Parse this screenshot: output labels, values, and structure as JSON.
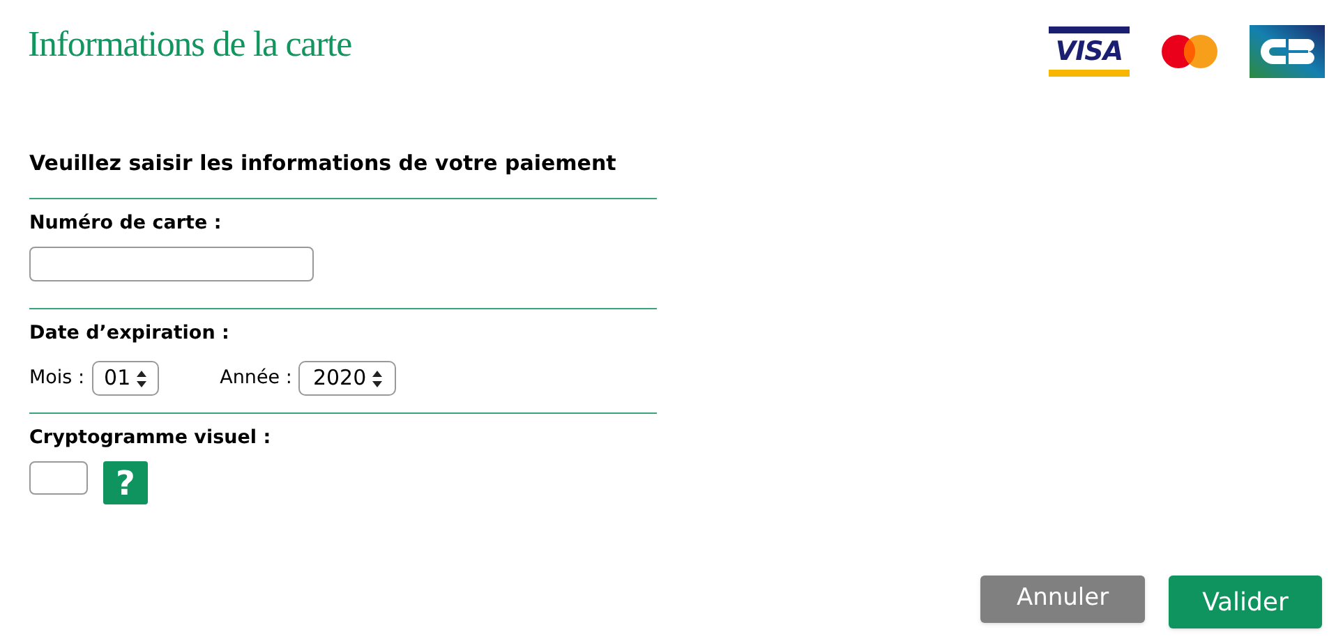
{
  "title": "Informations de la carte",
  "card_logos": [
    {
      "kind": "visa",
      "text": "VISA"
    },
    {
      "kind": "mastercard"
    },
    {
      "kind": "cb"
    }
  ],
  "heading": "Veuillez saisir les informations de votre paiement",
  "card_number": {
    "label": "Numéro de carte :"
  },
  "expiry": {
    "label": "Date d’expiration :",
    "month_label": "Mois :",
    "month": "01",
    "year_label": "Année :",
    "year": "2020"
  },
  "cvv": {
    "label": "Cryptogramme visuel :",
    "help": "?"
  },
  "buttons": [
    {
      "kind": "secondary",
      "label": "Annuler"
    },
    {
      "kind": "primary",
      "label": "Valider"
    }
  ]
}
